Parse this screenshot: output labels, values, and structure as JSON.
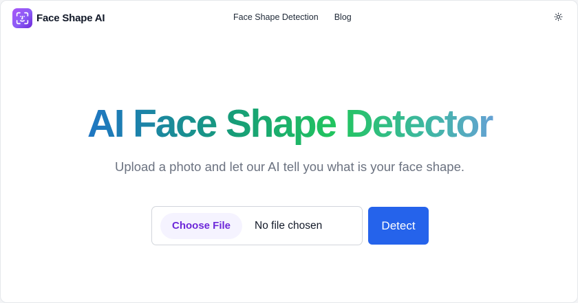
{
  "header": {
    "brand": "Face Shape AI",
    "logo_icon": "face-scan-icon",
    "nav": [
      {
        "label": "Face Shape Detection"
      },
      {
        "label": "Blog"
      }
    ],
    "theme_icon": "sun-icon"
  },
  "hero": {
    "title": "AI Face Shape Detector",
    "subtitle": "Upload a photo and let our AI tell you what is your face shape."
  },
  "upload": {
    "choose_label": "Choose File",
    "status": "No file chosen",
    "detect_label": "Detect"
  },
  "colors": {
    "brand_purple": "#8b5cf6",
    "primary_blue": "#2563eb",
    "gradient_start": "#2563eb",
    "gradient_mid": "#22c55e",
    "gradient_end": "#818cf8"
  }
}
